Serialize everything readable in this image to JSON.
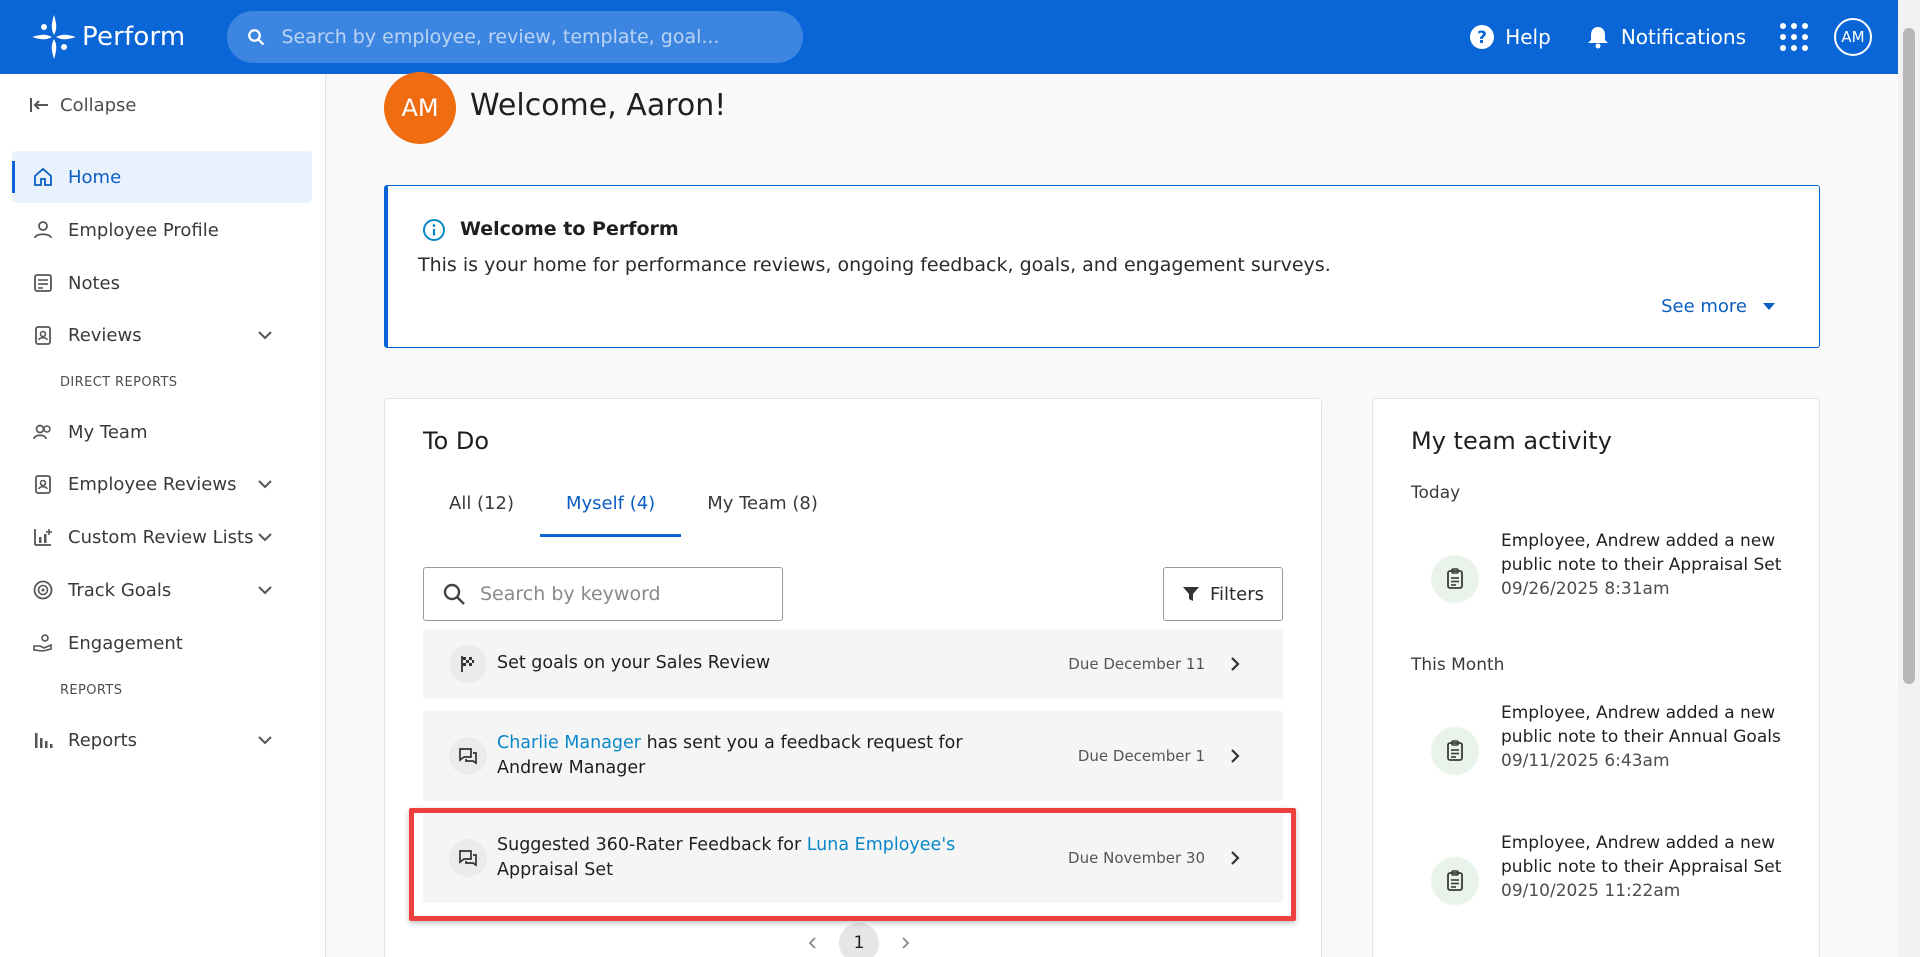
{
  "app": {
    "name": "Perform",
    "search_placeholder": "Search by employee, review, template, goal...",
    "help_label": "Help",
    "notifications_label": "Notifications",
    "user_initials": "AM"
  },
  "sidebar": {
    "collapse_label": "Collapse",
    "items": [
      {
        "label": "Home"
      },
      {
        "label": "Employee Profile"
      },
      {
        "label": "Notes"
      },
      {
        "label": "Reviews"
      },
      {
        "label": "My Team"
      },
      {
        "label": "Employee Reviews"
      },
      {
        "label": "Custom Review Lists"
      },
      {
        "label": "Track Goals"
      },
      {
        "label": "Engagement"
      },
      {
        "label": "Reports"
      }
    ],
    "sections": {
      "direct_reports": "DIRECT REPORTS",
      "reports": "REPORTS"
    }
  },
  "welcome": {
    "initials": "AM",
    "title": "Welcome, Aaron!"
  },
  "info_box": {
    "title": "Welcome to Perform",
    "body": "This is your home for performance reviews, ongoing feedback, goals, and engagement surveys.",
    "see_more": "See more"
  },
  "todo": {
    "title": "To Do",
    "tabs": [
      {
        "label": "All (12)"
      },
      {
        "label": "Myself (4)"
      },
      {
        "label": "My Team (8)"
      }
    ],
    "search_placeholder": "Search by keyword",
    "filters_label": "Filters",
    "tasks": [
      {
        "text": "Set goals on your Sales Review",
        "due": "Due December 11"
      },
      {
        "link": "Charlie Manager",
        "text_after": " has sent you a feedback request for",
        "line2": "Andrew Manager",
        "due": "Due December 1"
      },
      {
        "text_before": "Suggested 360-Rater Feedback for ",
        "link": "Luna Employee's",
        "line2": "Appraisal Set",
        "due": "Due November 30"
      }
    ],
    "page": "1"
  },
  "team_activity": {
    "title": "My team activity",
    "groups": {
      "today": "Today",
      "this_month": "This Month"
    },
    "items": [
      {
        "text": "Employee, Andrew added a new public note to their Appraisal Set",
        "time": "09/26/2025 8:31am"
      },
      {
        "text": "Employee, Andrew added a new public note to their Annual Goals",
        "time": "09/11/2025 6:43am"
      },
      {
        "text": "Employee, Andrew added a new public note to their Appraisal Set",
        "time": "09/10/2025 11:22am"
      }
    ]
  },
  "colors": {
    "brand": "#0a66d6",
    "avatar": "#ef6c10",
    "link": "#0a87c9",
    "highlight": "#ef4040"
  }
}
